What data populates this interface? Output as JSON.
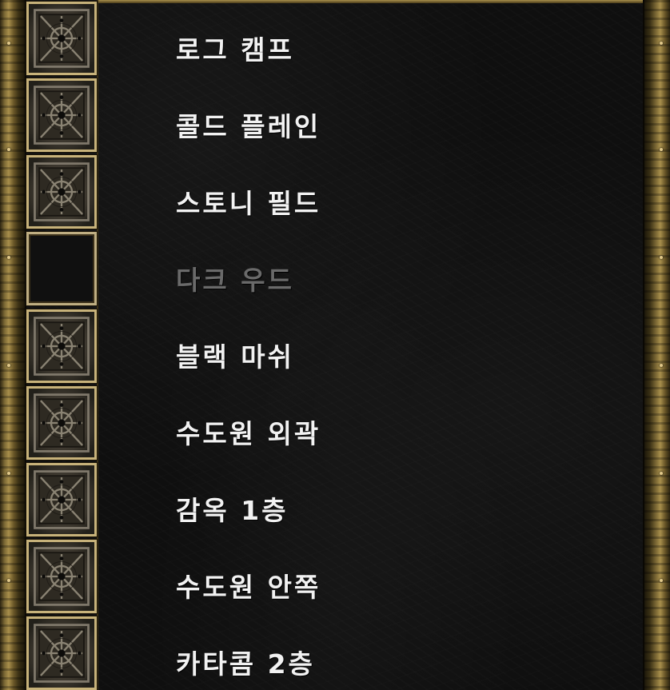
{
  "waypoints": [
    {
      "label": "로그 캠프",
      "enabled": true
    },
    {
      "label": "콜드 플레인",
      "enabled": true
    },
    {
      "label": "스토니 필드",
      "enabled": true
    },
    {
      "label": "다크 우드",
      "enabled": false
    },
    {
      "label": "블랙 마쉬",
      "enabled": true
    },
    {
      "label": "수도원 외곽",
      "enabled": true
    },
    {
      "label": "감옥 1층",
      "enabled": true
    },
    {
      "label": "수도원 안쪽",
      "enabled": true
    },
    {
      "label": "카타콤 2층",
      "enabled": true
    }
  ],
  "colors": {
    "frame_gold": "#a88f4c",
    "label_active": "#f2f2f2",
    "label_locked": "#6a6a6a",
    "panel_bg": "#0f0f0f"
  },
  "icons": {
    "waypoint_icon": "waypoint-rune-icon"
  }
}
